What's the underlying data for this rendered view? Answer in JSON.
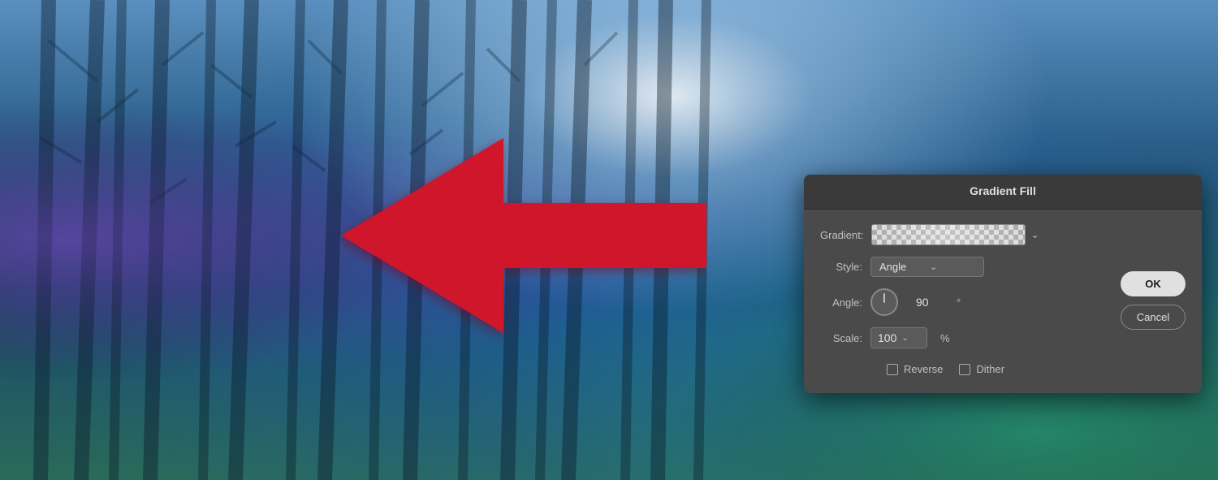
{
  "background": {
    "alt": "Forest trees looking up with blue-purple tones"
  },
  "arrow": {
    "color": "#d0142a",
    "shadow_color": "#8a0000"
  },
  "dialog": {
    "title": "Gradient Fill",
    "gradient_label": "Gradient:",
    "style_label": "Style:",
    "style_value": "Angle",
    "angle_label": "Angle:",
    "angle_value": "90",
    "degree_symbol": "°",
    "scale_label": "Scale:",
    "scale_value": "100",
    "scale_dropdown_symbol": "⌄",
    "percent_symbol": "%",
    "reverse_label": "Reverse",
    "dither_label": "Dither",
    "ok_label": "OK",
    "cancel_label": "Cancel"
  }
}
